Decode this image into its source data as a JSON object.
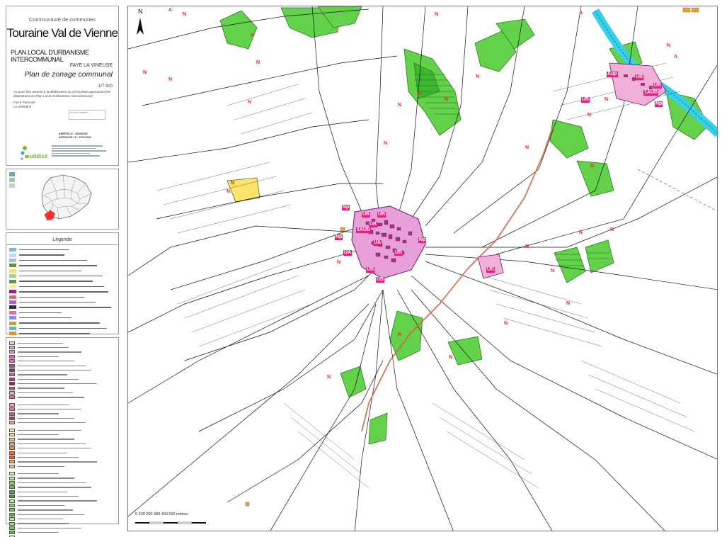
{
  "title_block": {
    "community": "Communauté de communes",
    "name": "Touraine Val de Vienne",
    "document": "PLAN LOCAL D'URBANISME INTERCOMMUNAL",
    "commune": "FAYE LA VINEUSE",
    "plan": "Plan de zonage communal",
    "scale": "1/7 800",
    "approval": "Vu pour être annexé à la délibération du 27/01/2020 approuvant les dispositions du Plan Local d'Urbanisme Intercommunal",
    "done_at": "Fait à Panzoult",
    "president": "Le président",
    "stamp": "Christian PIMBERT",
    "arrete": "ARRETE LE : 29/04/2019",
    "approuve": "APPROUVE LE : 27/01/2020",
    "logo": "auddicé"
  },
  "legend": {
    "heading": "Légende",
    "swatch_colors": [
      "#7fb8d8",
      "#c0d8f0",
      "#a0c0e0",
      "#6c8c3c",
      "#f0e070",
      "#8ed8a0",
      "#5a9a3a",
      "#f8f0a0",
      "#c000c0",
      "#d07070",
      "#b060d0",
      "#303030",
      "#ff60a0",
      "#8090f0",
      "#c0a040",
      "#40c0e0",
      "#e09030"
    ]
  },
  "zones_legend": {
    "swatch_colors_u": [
      "#f8d0e0",
      "#ff9ec4",
      "#ff80b0",
      "#ee60a0",
      "#f070c0",
      "#d0409a",
      "#b02070",
      "#e060a0",
      "#c03080",
      "#a02060",
      "#e0508a",
      "#f0a0c0",
      "#ff60a0"
    ],
    "swatch_colors_au": [
      "#ff9fb0",
      "#ff7088",
      "#ee5070",
      "#d03050",
      "#ff90a8"
    ],
    "swatch_colors_a": [
      "#ffe6b0",
      "#ffd090",
      "#ffb870",
      "#ff9c50",
      "#ff8840",
      "#f07030",
      "#e06020",
      "#f0a060",
      "#ffc080"
    ],
    "swatch_colors_n": [
      "#d0f0b0",
      "#a8e080",
      "#80d060",
      "#60c040",
      "#40b030",
      "#30a020",
      "#c0e890",
      "#90d070",
      "#70c050",
      "#50b040",
      "#b8e0a0",
      "#98d880",
      "#78c860",
      "#58b848",
      "#e0f4c8"
    ]
  },
  "map": {
    "north_label": "N",
    "scale_text": "0    100   200   300   400   500 mètres",
    "labels": [
      {
        "text": "A",
        "cls": "zl-A"
      },
      {
        "text": "N",
        "cls": "zl-N"
      },
      {
        "text": "N",
        "cls": "zl-N"
      },
      {
        "text": "A",
        "cls": "zl-A"
      },
      {
        "text": "N",
        "cls": "zl-N"
      },
      {
        "text": "N",
        "cls": "zl-N"
      },
      {
        "text": "N",
        "cls": "zl-N"
      },
      {
        "text": "N",
        "cls": "zl-N"
      },
      {
        "text": "A",
        "cls": "zl-A"
      },
      {
        "text": "Aup",
        "cls": "zl-U"
      },
      {
        "text": "UB",
        "cls": "zl-U"
      },
      {
        "text": "UB",
        "cls": "zl-U"
      },
      {
        "text": "1AUB",
        "cls": "zl-U"
      },
      {
        "text": "UB",
        "cls": "zl-U"
      },
      {
        "text": "N",
        "cls": "zl-N"
      },
      {
        "text": "Np",
        "cls": "zl-U"
      },
      {
        "text": "N",
        "cls": "zl-N"
      },
      {
        "text": "N",
        "cls": "zl-N"
      },
      {
        "text": "N",
        "cls": "zl-N"
      },
      {
        "text": "N",
        "cls": "zl-N"
      },
      {
        "text": "N",
        "cls": "zl-N"
      },
      {
        "text": "N",
        "cls": "zl-N"
      },
      {
        "text": "N",
        "cls": "zl-N"
      },
      {
        "text": "N",
        "cls": "zl-N"
      },
      {
        "text": "Np",
        "cls": "zl-U"
      },
      {
        "text": "UB",
        "cls": "zl-U"
      },
      {
        "text": "UB",
        "cls": "zl-U"
      },
      {
        "text": "1AUB",
        "cls": "zl-U"
      },
      {
        "text": "UB",
        "cls": "zl-U"
      },
      {
        "text": "UA",
        "cls": "zl-U"
      },
      {
        "text": "UB",
        "cls": "zl-U"
      },
      {
        "text": "Np",
        "cls": "zl-U"
      },
      {
        "text": "N",
        "cls": "zl-N"
      },
      {
        "text": "UA",
        "cls": "zl-U"
      },
      {
        "text": "UB",
        "cls": "zl-U"
      },
      {
        "text": "UB",
        "cls": "zl-U"
      },
      {
        "text": "UB",
        "cls": "zl-U"
      },
      {
        "text": "N",
        "cls": "zl-N"
      },
      {
        "text": "N",
        "cls": "zl-N"
      },
      {
        "text": "Np",
        "cls": "zl-U"
      },
      {
        "text": "N",
        "cls": "zl-N"
      },
      {
        "text": "N",
        "cls": "zl-N"
      },
      {
        "text": "N",
        "cls": "zl-N"
      },
      {
        "text": "N",
        "cls": "zl-N"
      },
      {
        "text": "N",
        "cls": "zl-N"
      },
      {
        "text": "N",
        "cls": "zl-N"
      },
      {
        "text": "N",
        "cls": "zl-N"
      },
      {
        "text": "N",
        "cls": "zl-N"
      },
      {
        "text": "N",
        "cls": "zl-N"
      },
      {
        "text": "N",
        "cls": "zl-N"
      },
      {
        "text": "N",
        "cls": "zl-N"
      }
    ]
  }
}
